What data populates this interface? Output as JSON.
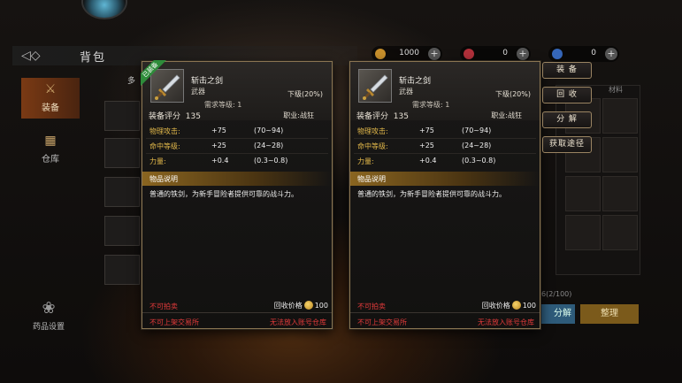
{
  "header": {
    "title": "背包"
  },
  "currencies": [
    {
      "icon": "gold-coin-icon",
      "value": "1000",
      "color": "#c8902c"
    },
    {
      "icon": "red-gem-icon",
      "value": "0",
      "color": "#b0303a"
    },
    {
      "icon": "blue-gem-icon",
      "value": "0",
      "color": "#3566b8"
    }
  ],
  "sidebar": {
    "tabs": [
      {
        "label": "装备",
        "icon": "sword-icon"
      },
      {
        "label": "仓库",
        "icon": "chest-icon"
      }
    ],
    "potion_settings": "药品设置"
  },
  "background_ui": {
    "bag_strip_label": "多",
    "capacity": "6(2/100)",
    "decompose_label": "分解",
    "sort_label": "整理",
    "grid_header": "材料"
  },
  "cards": [
    {
      "equipped_badge": "已装备",
      "name": "斩击之剑",
      "type": "武器",
      "quality": "下级(20%)",
      "required_level": "需求等级: 1",
      "score_label": "装备评分",
      "score": "135",
      "class_req": "职业:战狂",
      "stats": [
        {
          "name": "物理攻击:",
          "value": "+75",
          "range": "(70~94)"
        },
        {
          "name": "命中等级:",
          "value": "+25",
          "range": "(24~28)"
        },
        {
          "name": "力量:",
          "value": "+0.4",
          "range": "(0.3~0.8)"
        }
      ],
      "desc_title": "物品说明",
      "desc": "普通的铁剑，为新手冒险者提供可靠的战斗力。",
      "no_auction": "不可拍卖",
      "recycle_label": "回收价格",
      "recycle_value": "100",
      "no_shelf": "不可上架交易所",
      "no_warehouse": "无法放入账号仓库"
    },
    {
      "name": "斩击之剑",
      "type": "武器",
      "quality": "下级(20%)",
      "required_level": "需求等级: 1",
      "score_label": "装备评分",
      "score": "135",
      "class_req": "职业:战狂",
      "stats": [
        {
          "name": "物理攻击:",
          "value": "+75",
          "range": "(70~94)"
        },
        {
          "name": "命中等级:",
          "value": "+25",
          "range": "(24~28)"
        },
        {
          "name": "力量:",
          "value": "+0.4",
          "range": "(0.3~0.8)"
        }
      ],
      "desc_title": "物品说明",
      "desc": "普通的铁剑，为新手冒险者提供可靠的战斗力。",
      "no_auction": "不可拍卖",
      "recycle_label": "回收价格",
      "recycle_value": "100",
      "no_shelf": "不可上架交易所",
      "no_warehouse": "无法放入账号仓库"
    }
  ],
  "actions": [
    {
      "label": "装 备"
    },
    {
      "label": "回 收"
    },
    {
      "label": "分 解"
    },
    {
      "label": "获取途径"
    }
  ]
}
